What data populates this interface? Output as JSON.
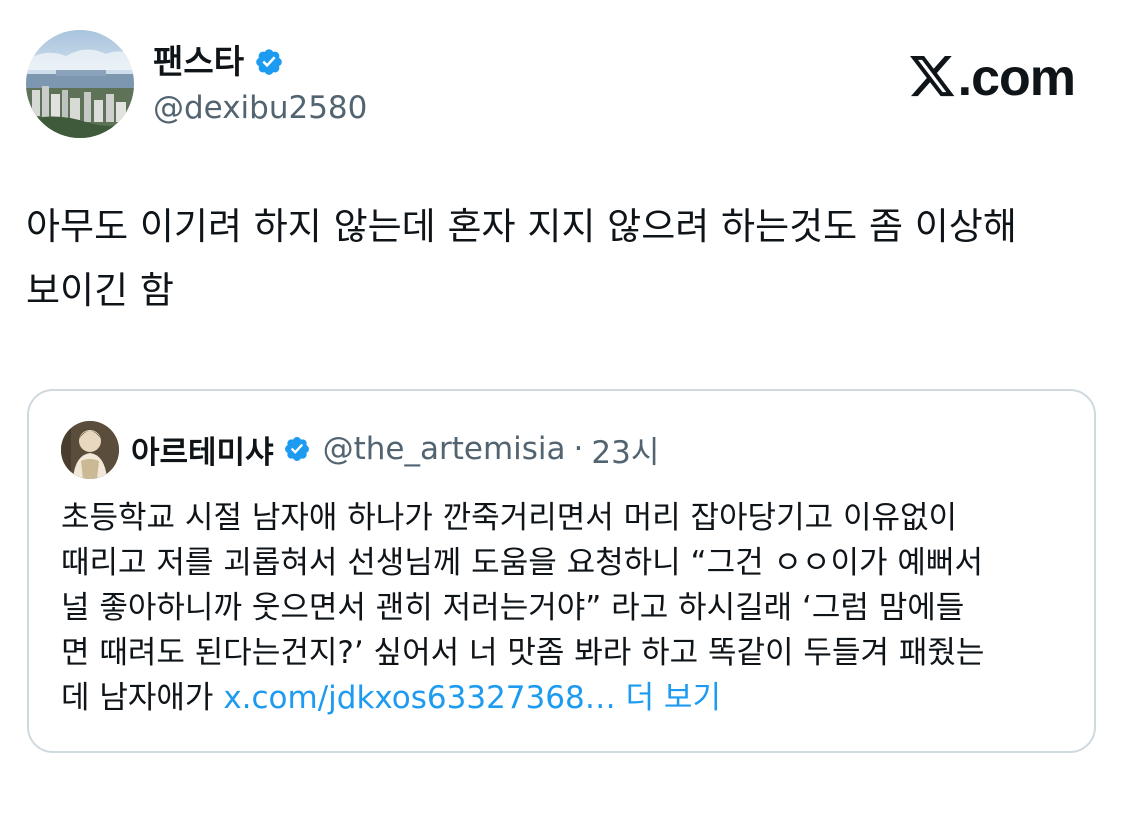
{
  "author": {
    "display_name": "팬스타",
    "handle": "@dexibu2580",
    "verified": true
  },
  "brand": {
    "text": ".com",
    "logo_icon": "x-logo-icon"
  },
  "tweet": {
    "text": "아무도 이기려 하지 않는데 혼자 지지 않으려 하는것도 좀 이상해\n보이긴 함"
  },
  "quoted": {
    "display_name": "아르테미샤",
    "handle": "@the_artemisia",
    "separator": "·",
    "time": "23시",
    "verified": true,
    "body": "초등학교 시절 남자애 하나가 깐죽거리면서 머리 잡아당기고 이유없이\n때리고 저를 괴롭혀서 선생님께 도움을 요청하니 “그건 ㅇㅇ이가 예뻐서\n널 좋아하니까 웃으면서 괜히 저러는거야” 라고 하시길래 ‘그럼 맘에들\n면 때려도 된다는건지?’ 싶어서 너 맛좀 봐라 하고 똑같이 두들겨 패줬는\n데 남자애가 ",
    "link": "x.com/jdkxos63327368…",
    "more": "더 보기"
  },
  "colors": {
    "verified_blue": "#1d9bf0",
    "text_primary": "#0f1419",
    "text_secondary": "#536471",
    "border": "#cfd9de"
  }
}
